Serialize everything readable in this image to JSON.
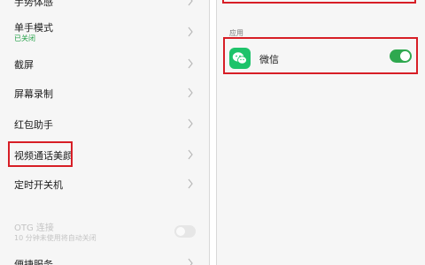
{
  "left_list": {
    "top_partial_label": "手势体感",
    "items": [
      {
        "label": "单手模式",
        "sub": "已关闭"
      },
      {
        "label": "截屏"
      },
      {
        "label": "屏幕录制"
      },
      {
        "label": "红包助手"
      },
      {
        "label": "视频通话美颜"
      },
      {
        "label": "定时开关机"
      },
      {
        "label": "OTG 连接",
        "sub": "10 分钟未使用将自动关闭",
        "disabled": true,
        "toggle": "off"
      },
      {
        "label": "便捷服务"
      }
    ]
  },
  "right_panel": {
    "section_label": "应用",
    "apps": [
      {
        "name": "微信",
        "icon": "wechat-icon",
        "toggle": "on"
      }
    ]
  },
  "colors": {
    "highlight": "#d71e26",
    "toggle_on": "#2fa84f",
    "status_green": "#24a148",
    "wechat_green": "#1ec36a"
  }
}
